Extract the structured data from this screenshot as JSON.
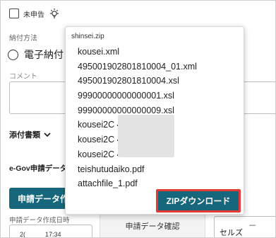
{
  "form": {
    "unfiled_label": "未申告",
    "payment_method_label": "納付方法",
    "payment_option_label": "電子納付",
    "comment_label": "コメント",
    "attachments_label": "添付書類",
    "egov_label": "e-Gov申請データ",
    "create_button_label": "申請データ作",
    "created_datetime_label": "申請データ作成日時",
    "date_fragment": "2(",
    "time_fragment": "17:34",
    "confirm_label": "申請データ確認",
    "select_fragment": "セルズ",
    "right_fragment": "一"
  },
  "zip": {
    "title": "shinsei.zip",
    "files": [
      "kousei.xml",
      "495001902801810004_01.xml",
      "495001902801810004.xsl",
      "99900000000000001.xsl",
      "99900000000000009.xsl",
      "kousei2C                    4000.xml",
      "kousei2C                    4001.xml",
      "kousei2C                    4002.xml",
      "teishutudaiko.pdf",
      "attachfile_1.pdf"
    ],
    "download_label": "ZIPダウンロード"
  },
  "colors": {
    "primary": "#17677c",
    "highlight_border": "#e53935"
  },
  "icons": {
    "bulb": "lightbulb-icon",
    "chevron": "chevron-down-icon"
  }
}
